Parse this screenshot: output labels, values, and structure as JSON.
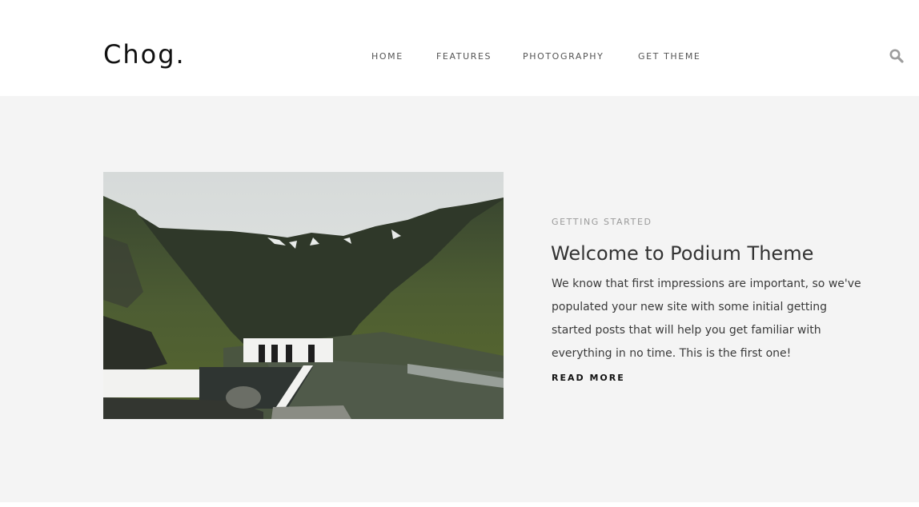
{
  "site": {
    "logo": "Chog."
  },
  "nav": {
    "items": [
      {
        "label": "HOME"
      },
      {
        "label": "FEATURES"
      },
      {
        "label": "PHOTOGRAPHY"
      },
      {
        "label": "GET THEME"
      }
    ],
    "search_icon": "search-icon"
  },
  "post": {
    "tag": "GETTING STARTED",
    "title": "Welcome to Podium Theme",
    "excerpt": "We know that first impressions are important, so we've populated your new site with some initial getting started posts that will help you get familiar with everything in no time. This is the first one!",
    "read_more": "READ MORE",
    "image_subject": "mountain valley with white pool house"
  },
  "colors": {
    "header_bg": "#ffffff",
    "hero_bg": "#f4f4f4",
    "text_dark": "#333333",
    "text_muted": "#9a9a9a"
  }
}
